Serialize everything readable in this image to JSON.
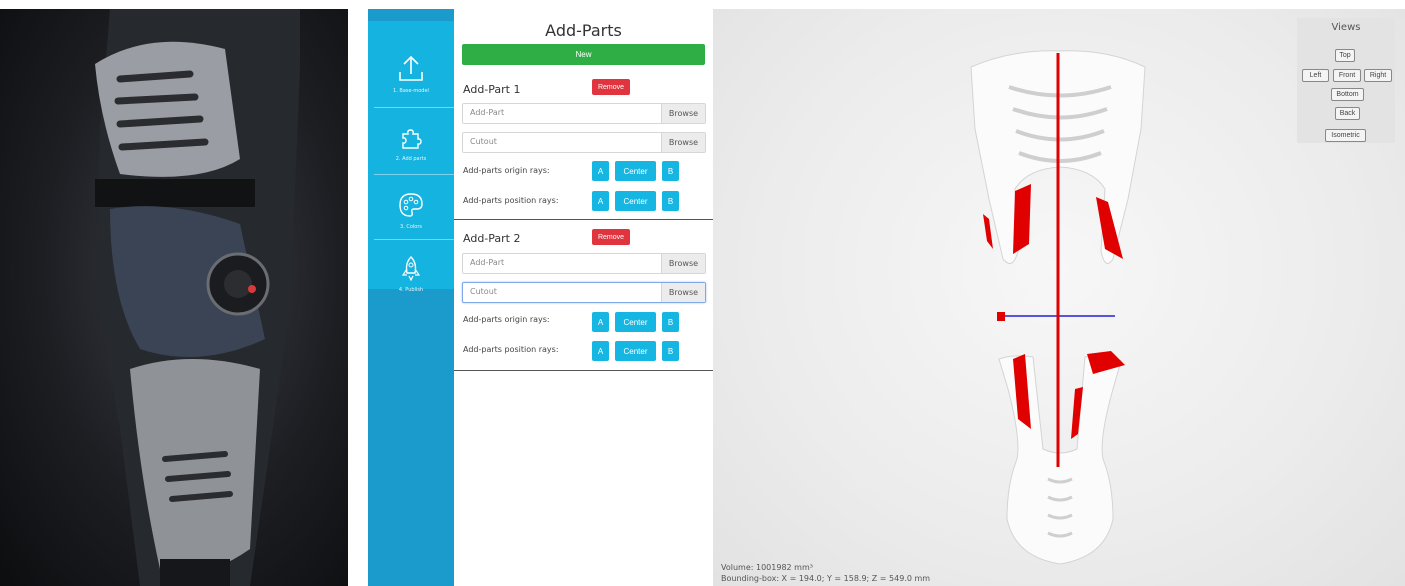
{
  "sidebar": {
    "steps": [
      {
        "label": "1. Base-model",
        "icon": "upload-icon"
      },
      {
        "label": "2. Add parts",
        "icon": "puzzle-icon"
      },
      {
        "label": "3. Colors",
        "icon": "palette-icon"
      },
      {
        "label": "4. Publish",
        "icon": "rocket-icon"
      }
    ]
  },
  "panel": {
    "title": "Add-Parts",
    "new_label": "New",
    "parts": [
      {
        "title": "Add-Part 1",
        "remove_label": "Remove",
        "addpart_placeholder": "Add-Part",
        "cutout_placeholder": "Cutout",
        "browse_label": "Browse",
        "origin_label": "Add-parts origin rays:",
        "position_label": "Add-parts position rays:",
        "ray_a": "A",
        "ray_center": "Center",
        "ray_b": "B"
      },
      {
        "title": "Add-Part 2",
        "remove_label": "Remove",
        "addpart_placeholder": "Add-Part",
        "cutout_placeholder": "Cutout",
        "browse_label": "Browse",
        "origin_label": "Add-parts origin rays:",
        "position_label": "Add-parts position rays:",
        "ray_a": "A",
        "ray_center": "Center",
        "ray_b": "B"
      }
    ]
  },
  "views": {
    "title": "Views",
    "top": "Top",
    "left": "Left",
    "front": "Front",
    "right": "Right",
    "bottom": "Bottom",
    "back": "Back",
    "isometric": "Isometric"
  },
  "status": {
    "volume": "Volume: 1001982 mm³",
    "bbox": "Bounding-box: X = 194.0; Y = 158.9; Z = 549.0 mm"
  },
  "colors": {
    "sidebar": "#1a9bcc",
    "step_bg": "#15b3df",
    "new_green": "#2fae46",
    "remove_red": "#e0343e",
    "ray_blue": "#16b6e3",
    "marker_red": "#e00000"
  }
}
